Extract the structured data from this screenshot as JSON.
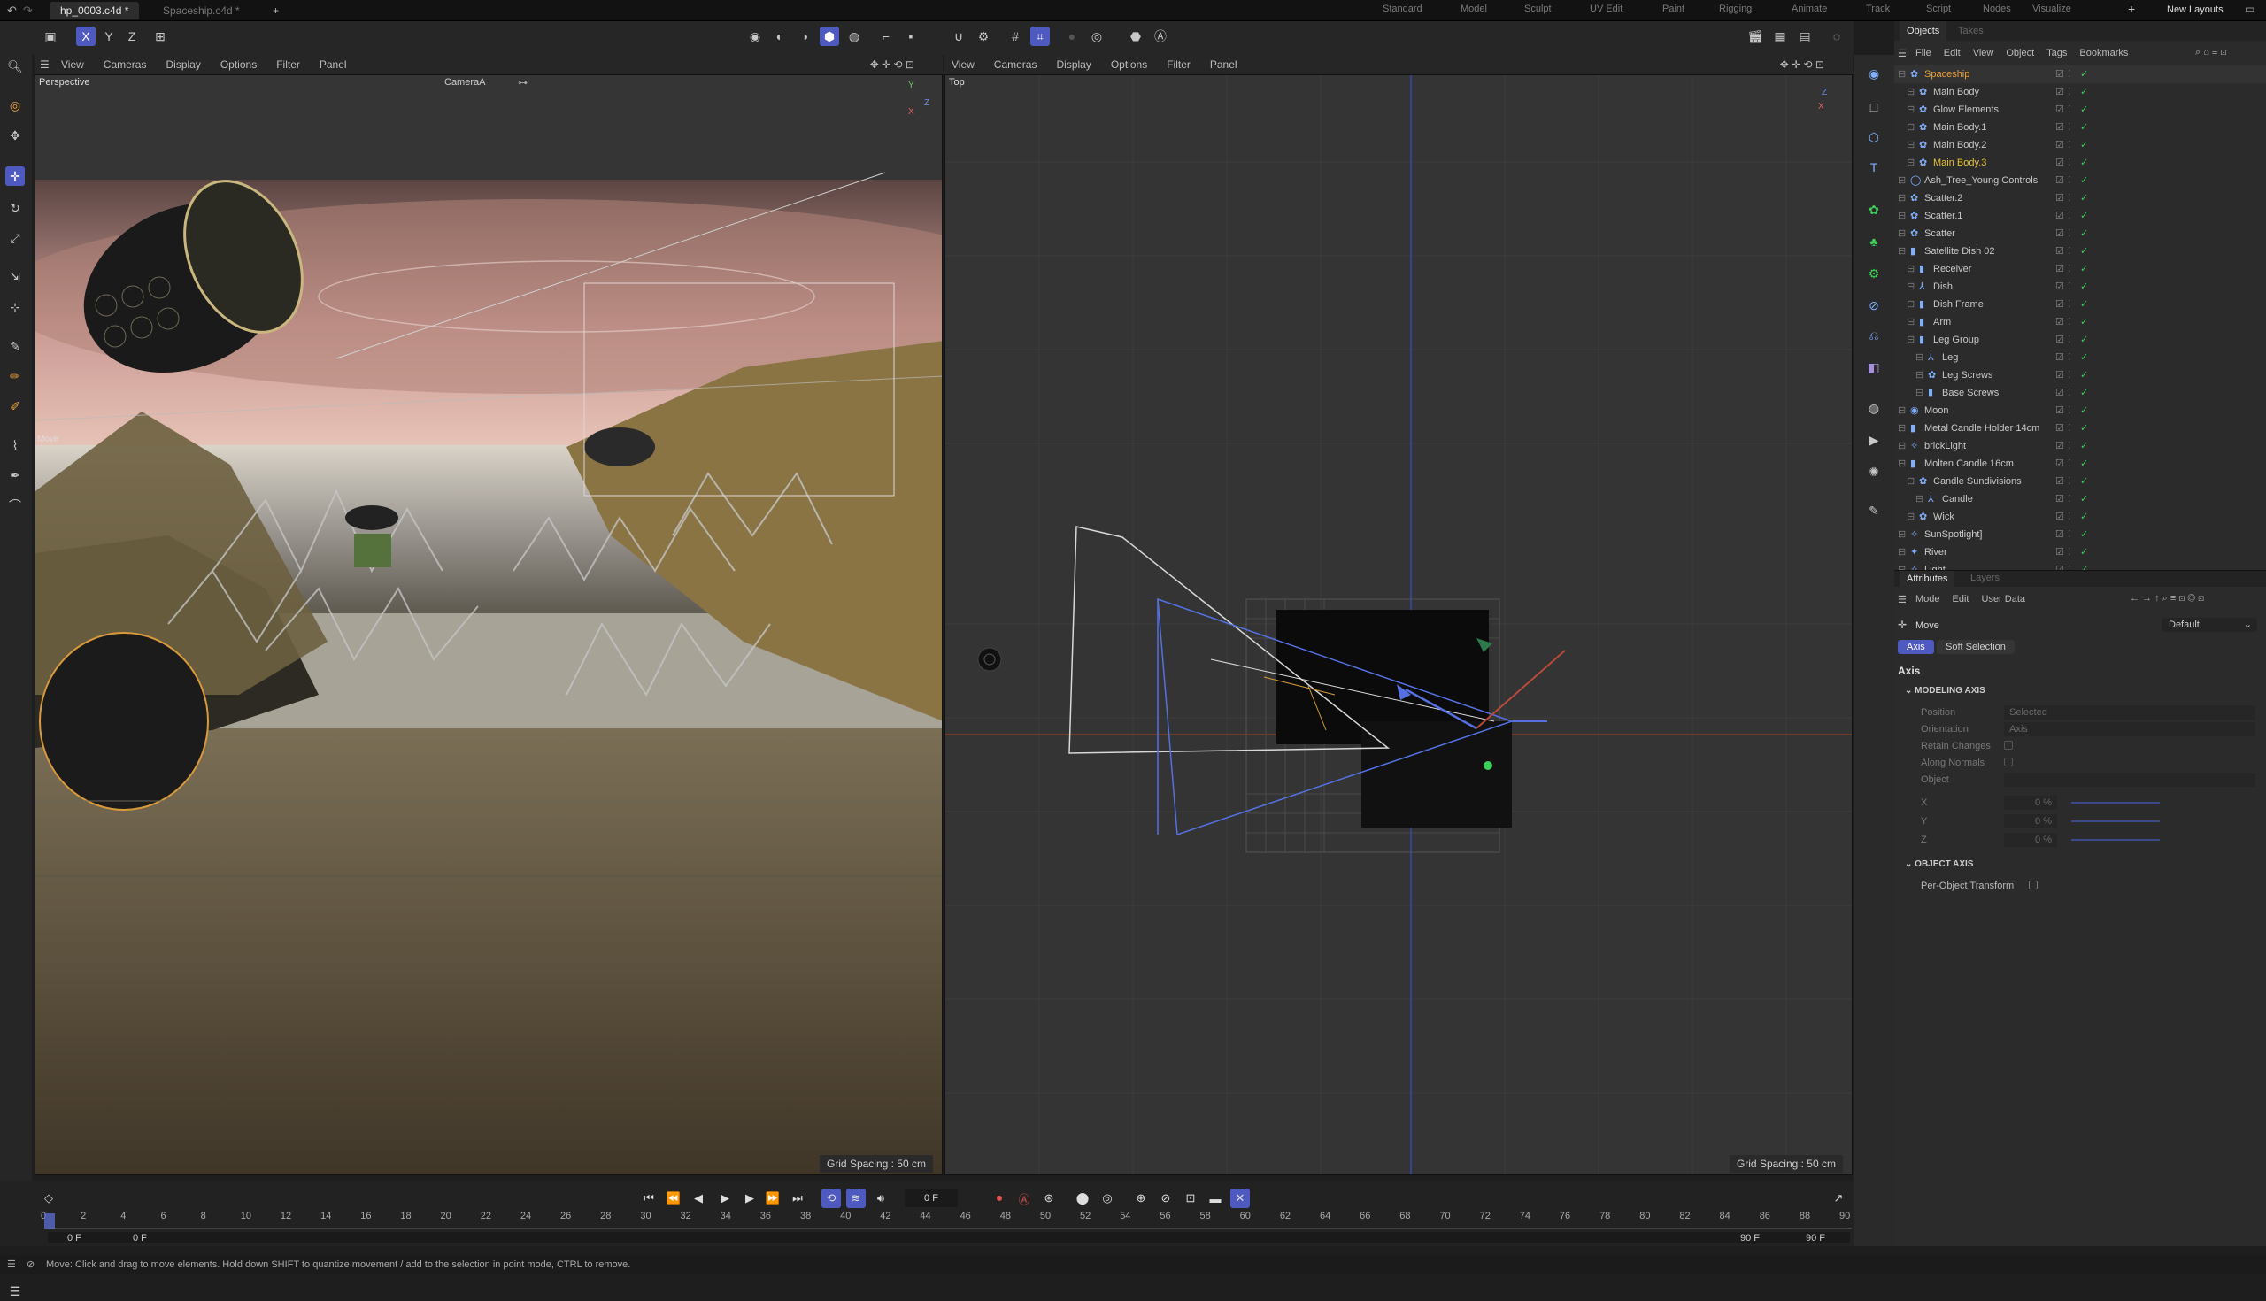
{
  "tabs": {
    "active": "hp_0003.c4d *",
    "inactive": "Spaceship.c4d *",
    "add": "+"
  },
  "layouts": [
    "Standard",
    "Model",
    "Sculpt",
    "UV Edit",
    "Paint",
    "Rigging",
    "Animate",
    "Track",
    "Script",
    "Nodes",
    "Visualize"
  ],
  "new_layouts": "New Layouts",
  "axis_buttons": {
    "x": "X",
    "y": "Y",
    "z": "Z"
  },
  "viewport_menu": [
    "View",
    "Cameras",
    "Display",
    "Options",
    "Filter",
    "Panel"
  ],
  "viewport_left": {
    "name": "Perspective",
    "camera": "CameraA",
    "grid": "Grid Spacing : 50 cm",
    "move_label": "Move"
  },
  "viewport_right": {
    "name": "Top",
    "grid": "Grid Spacing : 50 cm"
  },
  "objects_panel": {
    "tabs": [
      "Objects",
      "Takes"
    ],
    "menu": [
      "File",
      "Edit",
      "View",
      "Object",
      "Tags",
      "Bookmarks"
    ],
    "items": [
      {
        "name": "Spaceship",
        "indent": 0,
        "color": "#e8a23a"
      },
      {
        "name": "Main Body",
        "indent": 1,
        "color": "#c8c8c8"
      },
      {
        "name": "Glow Elements",
        "indent": 1,
        "color": "#c8c8c8"
      },
      {
        "name": "Main Body.1",
        "indent": 1,
        "color": "#c8c8c8"
      },
      {
        "name": "Main Body.2",
        "indent": 1,
        "color": "#c8c8c8"
      },
      {
        "name": "Main Body.3",
        "indent": 1,
        "color": "#e8c23a"
      },
      {
        "name": "Ash_Tree_Young Controls",
        "indent": 0,
        "color": "#c8c8c8"
      },
      {
        "name": "Scatter.2",
        "indent": 0,
        "color": "#c8c8c8"
      },
      {
        "name": "Scatter.1",
        "indent": 0,
        "color": "#c8c8c8"
      },
      {
        "name": "Scatter",
        "indent": 0,
        "color": "#c8c8c8"
      },
      {
        "name": "Satellite Dish 02",
        "indent": 0,
        "color": "#c8c8c8"
      },
      {
        "name": "Receiver",
        "indent": 1,
        "color": "#c8c8c8"
      },
      {
        "name": "Dish",
        "indent": 1,
        "color": "#c8c8c8"
      },
      {
        "name": "Dish Frame",
        "indent": 1,
        "color": "#c8c8c8"
      },
      {
        "name": "Arm",
        "indent": 1,
        "color": "#c8c8c8"
      },
      {
        "name": "Leg Group",
        "indent": 1,
        "color": "#c8c8c8"
      },
      {
        "name": "Leg",
        "indent": 2,
        "color": "#c8c8c8"
      },
      {
        "name": "Leg Screws",
        "indent": 2,
        "color": "#c8c8c8"
      },
      {
        "name": "Base Screws",
        "indent": 2,
        "color": "#c8c8c8"
      },
      {
        "name": "Moon",
        "indent": 0,
        "color": "#c8c8c8"
      },
      {
        "name": "Metal Candle Holder 14cm",
        "indent": 0,
        "color": "#c8c8c8"
      },
      {
        "name": "brickLight",
        "indent": 0,
        "color": "#c8c8c8"
      },
      {
        "name": "Molten Candle 16cm",
        "indent": 0,
        "color": "#c8c8c8"
      },
      {
        "name": "Candle Sundivisions",
        "indent": 1,
        "color": "#c8c8c8"
      },
      {
        "name": "Candle",
        "indent": 2,
        "color": "#c8c8c8"
      },
      {
        "name": "Wick",
        "indent": 1,
        "color": "#c8c8c8"
      },
      {
        "name": "SunSpotlight]",
        "indent": 0,
        "color": "#c8c8c8"
      },
      {
        "name": "River",
        "indent": 0,
        "color": "#c8c8c8"
      },
      {
        "name": "Light",
        "indent": 0,
        "color": "#c8c8c8"
      }
    ]
  },
  "attributes_panel": {
    "tabs": [
      "Attributes",
      "Layers"
    ],
    "menu": [
      "Mode",
      "Edit",
      "User Data"
    ],
    "tool": "Move",
    "preset": "Default",
    "subtabs": [
      "Axis",
      "Soft Selection"
    ],
    "section": "Axis",
    "group1": "MODELING AXIS",
    "fields": [
      {
        "label": "Position",
        "value": "Selected"
      },
      {
        "label": "Orientation",
        "value": "Axis"
      },
      {
        "label": "Retain Changes",
        "value": ""
      },
      {
        "label": "Along Normals",
        "value": ""
      },
      {
        "label": "Object",
        "value": ""
      },
      {
        "label": "X",
        "value": "0 %"
      },
      {
        "label": "Y",
        "value": "0 %"
      },
      {
        "label": "Z",
        "value": "0 %"
      }
    ],
    "group2": "OBJECT AXIS",
    "per_object": "Per-Object Transform"
  },
  "timeline": {
    "current_frame": "0 F",
    "start": "0 F",
    "start2": "0 F",
    "end": "90 F",
    "end2": "90 F",
    "ticks": [
      "0",
      "2",
      "4",
      "6",
      "8",
      "10",
      "12",
      "14",
      "16",
      "18",
      "20",
      "22",
      "24",
      "26",
      "28",
      "30",
      "32",
      "34",
      "36",
      "38",
      "40",
      "42",
      "44",
      "46",
      "48",
      "50",
      "52",
      "54",
      "56",
      "58",
      "60",
      "62",
      "64",
      "66",
      "68",
      "70",
      "72",
      "74",
      "76",
      "78",
      "80",
      "82",
      "84",
      "86",
      "88",
      "90"
    ]
  },
  "status": "Move: Click and drag to move elements. Hold down SHIFT to quantize movement / add to the selection in point mode, CTRL to remove."
}
